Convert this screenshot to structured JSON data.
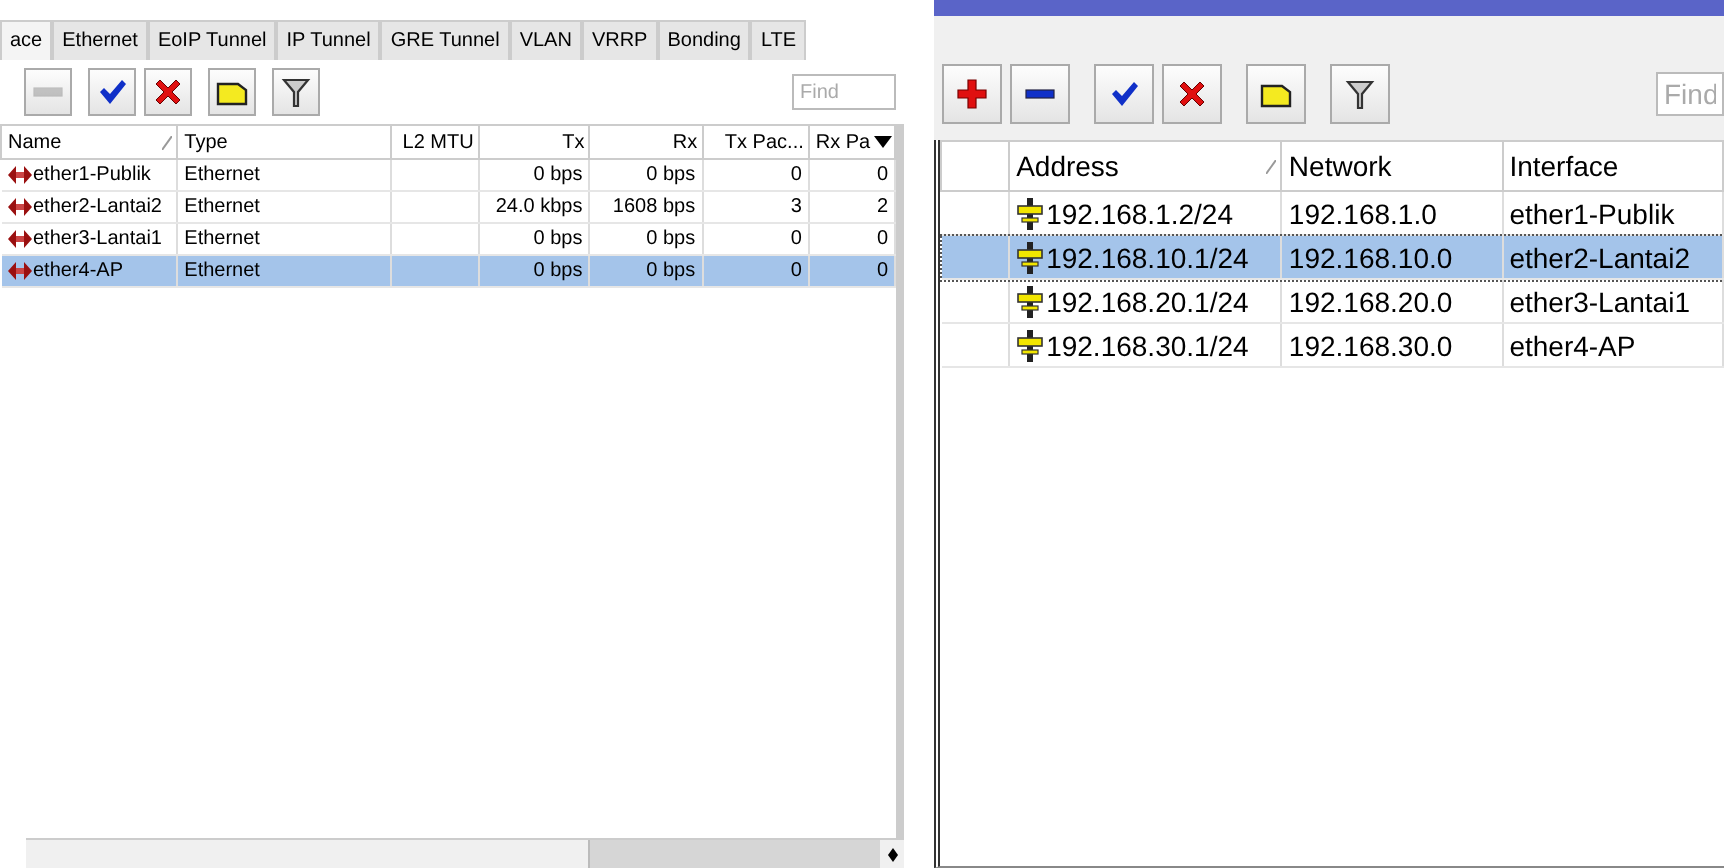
{
  "interfaces": {
    "tabs": [
      {
        "label": "ace",
        "selected": true
      },
      {
        "label": "Ethernet",
        "selected": false
      },
      {
        "label": "EoIP Tunnel",
        "selected": false
      },
      {
        "label": "IP Tunnel",
        "selected": false
      },
      {
        "label": "GRE Tunnel",
        "selected": false
      },
      {
        "label": "VLAN",
        "selected": false
      },
      {
        "label": "VRRP",
        "selected": false
      },
      {
        "label": "Bonding",
        "selected": false
      },
      {
        "label": "LTE",
        "selected": false
      }
    ],
    "toolbar": [
      {
        "kind": "remove",
        "disabled": true
      },
      {
        "kind": "enable",
        "disabled": false
      },
      {
        "kind": "disable",
        "disabled": false
      },
      {
        "kind": "comment",
        "disabled": false
      },
      {
        "kind": "filter",
        "disabled": false
      }
    ],
    "find": {
      "placeholder": "Find"
    },
    "table": {
      "columns": [
        {
          "label": "Name",
          "kind": "text",
          "sorted": true
        },
        {
          "label": "Type",
          "kind": "text",
          "sorted": false
        },
        {
          "label": "L2 MTU",
          "kind": "number",
          "sorted": false
        },
        {
          "label": "Tx",
          "kind": "number",
          "sorted": false
        },
        {
          "label": "Rx",
          "kind": "number",
          "sorted": false
        },
        {
          "label": "Tx Pac...",
          "kind": "number",
          "sorted": false
        },
        {
          "label": "Rx Pa",
          "kind": "number",
          "sorted": false
        }
      ],
      "rows": [
        {
          "kind": "interface",
          "cells": [
            "ether1-Publik",
            "Ethernet",
            "",
            "0 bps",
            "0 bps",
            "0",
            "0"
          ],
          "selected": false
        },
        {
          "kind": "interface",
          "cells": [
            "ether2-Lantai2",
            "Ethernet",
            "",
            "24.0 kbps",
            "1608 bps",
            "3",
            "2"
          ],
          "selected": false
        },
        {
          "kind": "interface",
          "cells": [
            "ether3-Lantai1",
            "Ethernet",
            "",
            "0 bps",
            "0 bps",
            "0",
            "0"
          ],
          "selected": false
        },
        {
          "kind": "interface",
          "cells": [
            "ether4-AP",
            "Ethernet",
            "",
            "0 bps",
            "0 bps",
            "0",
            "0"
          ],
          "selected": true
        }
      ]
    }
  },
  "address_list": {
    "toolbar": [
      {
        "kind": "add",
        "disabled": false
      },
      {
        "kind": "remove",
        "disabled": false
      },
      {
        "kind": "enable",
        "disabled": false
      },
      {
        "kind": "disable",
        "disabled": false
      },
      {
        "kind": "comment",
        "disabled": false
      },
      {
        "kind": "filter",
        "disabled": false
      }
    ],
    "find": {
      "placeholder": "Find"
    },
    "table": {
      "columns": [
        {
          "sorted": false
        },
        {
          "label": "Address",
          "sorted": true
        },
        {
          "label": "Network",
          "sorted": false
        },
        {
          "label": "Interface",
          "sorted": false
        }
      ],
      "rows": [
        {
          "kind": "address",
          "cells": [
            "",
            "192.168.1.2/24",
            "192.168.1.0",
            "ether1-Publik"
          ],
          "selected": false
        },
        {
          "kind": "address",
          "cells": [
            "",
            "192.168.10.1/24",
            "192.168.10.0",
            "ether2-Lantai2"
          ],
          "selected": true
        },
        {
          "kind": "address",
          "cells": [
            "",
            "192.168.20.1/24",
            "192.168.20.0",
            "ether3-Lantai1"
          ],
          "selected": false
        },
        {
          "kind": "address",
          "cells": [
            "",
            "192.168.30.1/24",
            "192.168.30.0",
            "ether4-AP"
          ],
          "selected": false
        }
      ]
    }
  }
}
